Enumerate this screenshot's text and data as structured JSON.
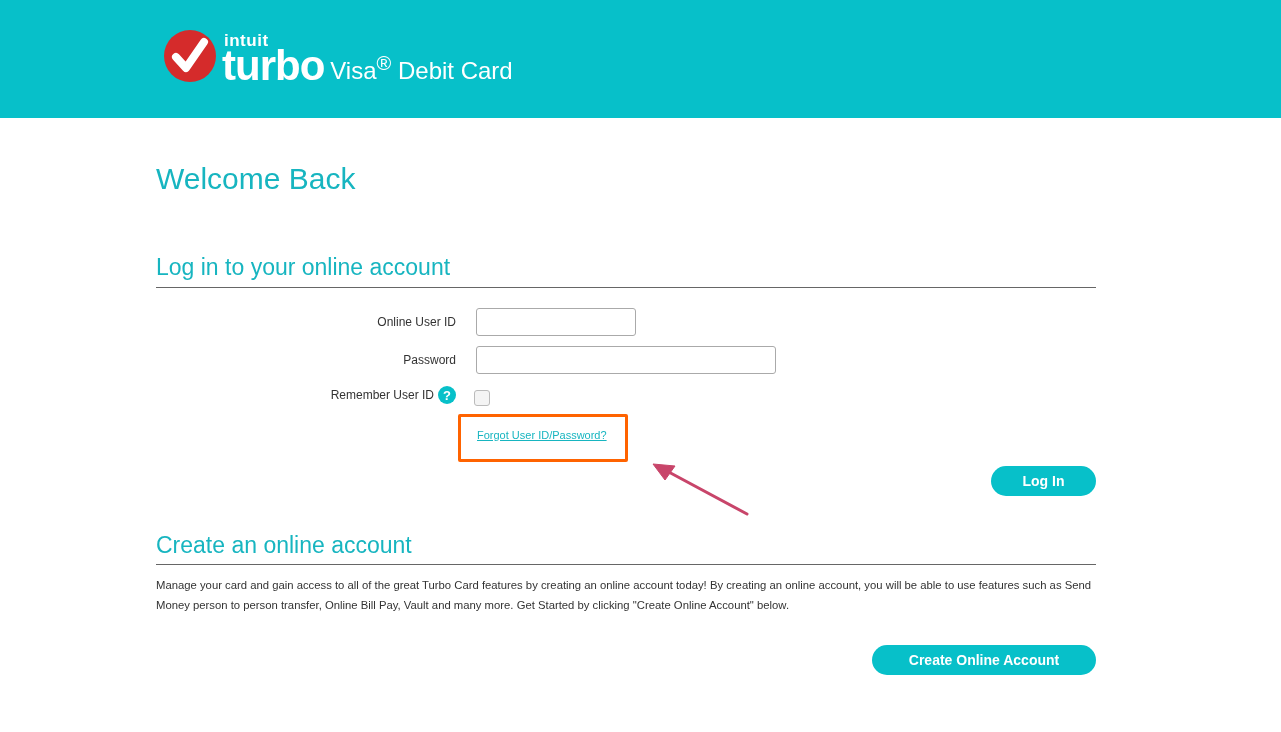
{
  "header": {
    "brand_top": "intuit",
    "brand_main": "turbo",
    "product": "Visa$^{®}$ Debit Card"
  },
  "title": "Welcome Back",
  "login": {
    "heading": "Log in to your online account",
    "fields": [
      {
        "label": "Online User ID",
        "kind": "short"
      },
      {
        "label": "Password",
        "kind": "long"
      }
    ],
    "remember": {
      "label": "Remember User ID",
      "help": "?",
      "checked": false
    },
    "forgot_link": "Forgot User ID/Password?",
    "button": "Log In"
  },
  "create": {
    "heading": "Create an online account",
    "text": "Manage your card and gain access to all of the great Turbo Card features by creating an online account today! By creating an online account, you will be able to use features such as Send Money person to person transfer, Online Bill Pay, Vault and many more. Get Started by clicking \"Create Online Account\" below.",
    "button": "Create Online Account"
  }
}
